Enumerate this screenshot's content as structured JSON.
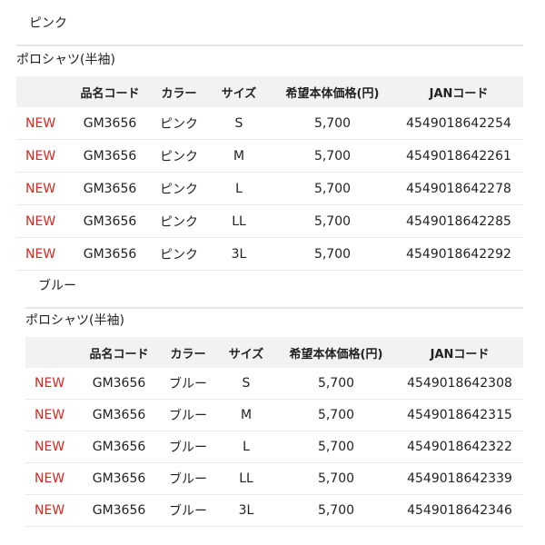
{
  "columns": [
    "",
    "品名コード",
    "カラー",
    "サイズ",
    "希望本体価格(円)",
    "JANコード"
  ],
  "sections": [
    {
      "color_label": "ピンク",
      "product_title": "ポロシャツ(半袖)",
      "rows": [
        {
          "badge": "NEW",
          "code": "GM3656",
          "color": "ピンク",
          "size": "S",
          "price": "5,700",
          "jan": "4549018642254"
        },
        {
          "badge": "NEW",
          "code": "GM3656",
          "color": "ピンク",
          "size": "M",
          "price": "5,700",
          "jan": "4549018642261"
        },
        {
          "badge": "NEW",
          "code": "GM3656",
          "color": "ピンク",
          "size": "L",
          "price": "5,700",
          "jan": "4549018642278"
        },
        {
          "badge": "NEW",
          "code": "GM3656",
          "color": "ピンク",
          "size": "LL",
          "price": "5,700",
          "jan": "4549018642285"
        },
        {
          "badge": "NEW",
          "code": "GM3656",
          "color": "ピンク",
          "size": "3L",
          "price": "5,700",
          "jan": "4549018642292"
        }
      ]
    },
    {
      "color_label": "ブルー",
      "product_title": "ポロシャツ(半袖)",
      "rows": [
        {
          "badge": "NEW",
          "code": "GM3656",
          "color": "ブルー",
          "size": "S",
          "price": "5,700",
          "jan": "4549018642308"
        },
        {
          "badge": "NEW",
          "code": "GM3656",
          "color": "ブルー",
          "size": "M",
          "price": "5,700",
          "jan": "4549018642315"
        },
        {
          "badge": "NEW",
          "code": "GM3656",
          "color": "ブルー",
          "size": "L",
          "price": "5,700",
          "jan": "4549018642322"
        },
        {
          "badge": "NEW",
          "code": "GM3656",
          "color": "ブルー",
          "size": "LL",
          "price": "5,700",
          "jan": "4549018642339"
        },
        {
          "badge": "NEW",
          "code": "GM3656",
          "color": "ブルー",
          "size": "3L",
          "price": "5,700",
          "jan": "4549018642346"
        }
      ]
    }
  ],
  "colors": {
    "badge": "#d7261e",
    "header_bg": "#f2f2f2",
    "row_border": "#e9e9e9"
  }
}
